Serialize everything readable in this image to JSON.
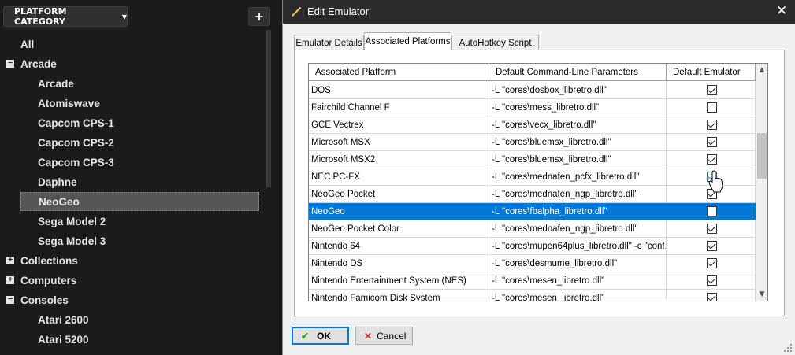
{
  "sidebar": {
    "category_button": "PLATFORM CATEGORY",
    "add_button": "+",
    "items": [
      {
        "label": "All",
        "level": "root",
        "expander": ""
      },
      {
        "label": "Arcade",
        "level": "root",
        "expander": "−"
      },
      {
        "label": "Arcade",
        "level": "child"
      },
      {
        "label": "Atomiswave",
        "level": "child"
      },
      {
        "label": "Capcom CPS-1",
        "level": "child"
      },
      {
        "label": "Capcom CPS-2",
        "level": "child"
      },
      {
        "label": "Capcom CPS-3",
        "level": "child"
      },
      {
        "label": "Daphne",
        "level": "child"
      },
      {
        "label": "NeoGeo",
        "level": "child",
        "selected": true
      },
      {
        "label": "Sega Model 2",
        "level": "child"
      },
      {
        "label": "Sega Model 3",
        "level": "child"
      },
      {
        "label": "Collections",
        "level": "root",
        "expander": "+"
      },
      {
        "label": "Computers",
        "level": "root",
        "expander": "+"
      },
      {
        "label": "Consoles",
        "level": "root",
        "expander": "−"
      },
      {
        "label": "Atari 2600",
        "level": "child"
      },
      {
        "label": "Atari 5200",
        "level": "child"
      }
    ]
  },
  "dialog": {
    "title": "Edit Emulator",
    "close_label": "✕",
    "tabs": [
      {
        "label": "Emulator Details",
        "active": false
      },
      {
        "label": "Associated Platforms",
        "active": true
      },
      {
        "label": "AutoHotkey Script",
        "active": false
      }
    ],
    "grid": {
      "columns": [
        "Associated Platform",
        "Default Command-Line Parameters",
        "Default Emulator"
      ],
      "rows": [
        {
          "platform": "DOS",
          "params": "-L \"cores\\dosbox_libretro.dll\"",
          "default": true
        },
        {
          "platform": "Fairchild Channel F",
          "params": "-L \"cores\\mess_libretro.dll\"",
          "default": false
        },
        {
          "platform": "GCE Vectrex",
          "params": "-L \"cores\\vecx_libretro.dll\"",
          "default": true
        },
        {
          "platform": "Microsoft MSX",
          "params": "-L \"cores\\bluemsx_libretro.dll\"",
          "default": true
        },
        {
          "platform": "Microsoft MSX2",
          "params": "-L \"cores\\bluemsx_libretro.dll\"",
          "default": true
        },
        {
          "platform": "NEC PC-FX",
          "params": "-L \"cores\\mednafen_pcfx_libretro.dll\"",
          "default": true,
          "hover": true
        },
        {
          "platform": "NeoGeo Pocket",
          "params": "-L \"cores\\mednafen_ngp_libretro.dll\"",
          "default": true
        },
        {
          "platform": "NeoGeo",
          "params": "-L \"cores\\fbalpha_libretro.dll\"",
          "default": false,
          "selected": true
        },
        {
          "platform": "NeoGeo Pocket Color",
          "params": "-L \"cores\\mednafen_ngp_libretro.dll\"",
          "default": true
        },
        {
          "platform": "Nintendo 64",
          "params": "-L \"cores\\mupen64plus_libretro.dll\" -c \"conf...",
          "default": true
        },
        {
          "platform": "Nintendo DS",
          "params": "-L \"cores\\desmume_libretro.dll\"",
          "default": true
        },
        {
          "platform": "Nintendo Entertainment System (NES)",
          "params": "-L \"cores\\mesen_libretro.dll\"",
          "default": true
        },
        {
          "platform": "Nintendo Famicom Disk System",
          "params": "-L \"cores\\mesen_libretro.dll\"",
          "default": true
        }
      ]
    },
    "ok_label": "OK",
    "cancel_label": "Cancel"
  },
  "colors": {
    "selection": "#0078d7",
    "sidebar_bg": "#1b1b1b",
    "ok_icon": "#2da82d",
    "cancel_icon": "#d22a2a"
  },
  "icons": {
    "title": "pencil-icon",
    "ok": "checkmark-icon",
    "cancel": "x-icon"
  }
}
